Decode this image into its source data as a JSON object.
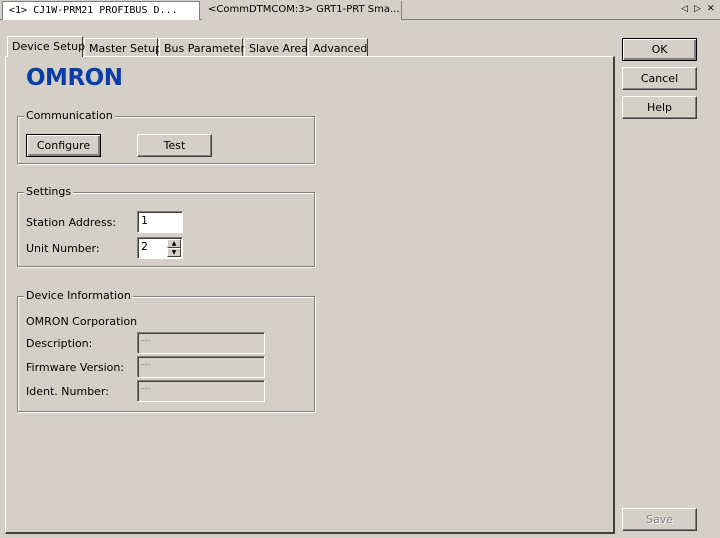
{
  "doc_tabs": {
    "active": "<1> CJ1W-PRM21 PROFIBUS D...",
    "inactive": "<CommDTMCOM:3> GRT1-PRT Sma..."
  },
  "nav": {
    "prev": "◁",
    "next": "▷",
    "close": "✕"
  },
  "tabs": [
    "Device Setup",
    "Master Setup",
    "Bus Parameters",
    "Slave Area",
    "Advanced"
  ],
  "logo": "OMRON",
  "communication": {
    "title": "Communication",
    "configure_label": "Configure",
    "test_label": "Test"
  },
  "settings": {
    "title": "Settings",
    "station_address_label": "Station Address:",
    "station_address_value": "1",
    "unit_number_label": "Unit Number:",
    "unit_number_value": "2"
  },
  "device_info": {
    "title": "Device Information",
    "vendor": "OMRON Corporation",
    "description_label": "Description:",
    "description_value": "---",
    "firmware_label": "Firmware Version:",
    "firmware_value": "---",
    "ident_label": "Ident. Number:",
    "ident_value": "---"
  },
  "side_buttons": {
    "ok": "OK",
    "cancel": "Cancel",
    "help": "Help",
    "save": "Save"
  },
  "colors": {
    "logo": "#0b3da8",
    "face": "#d4d0c8"
  }
}
